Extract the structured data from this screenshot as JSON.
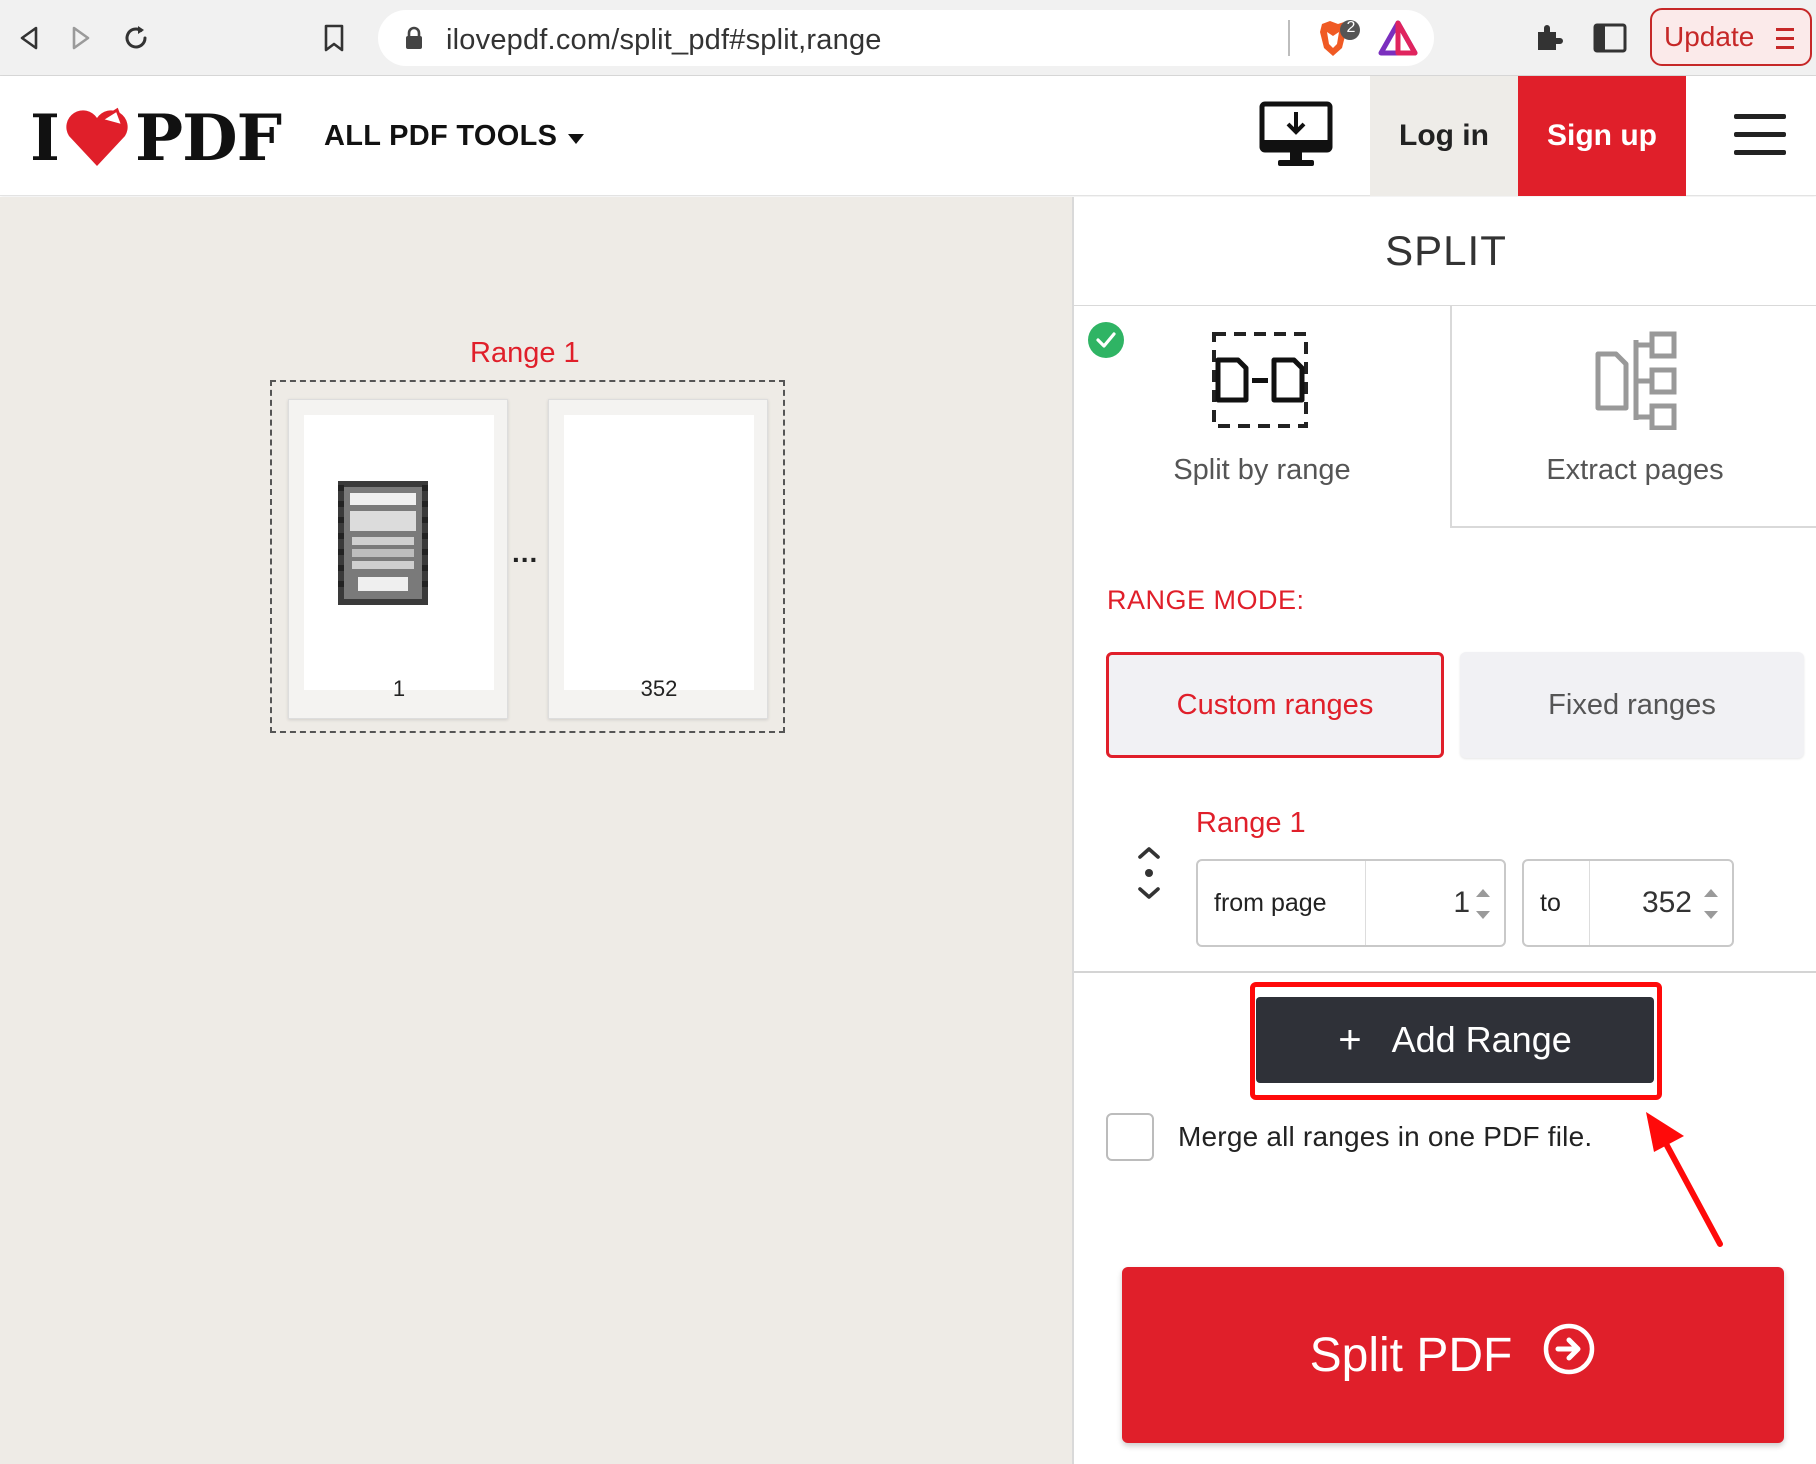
{
  "browser": {
    "url": "ilovepdf.com/split_pdf#split,range",
    "brave_badge_count": "2",
    "update_label": "Update"
  },
  "header": {
    "logo_left": "I",
    "logo_right": "PDF",
    "all_tools_label": "ALL PDF TOOLS",
    "login_label": "Log in",
    "signup_label": "Sign up"
  },
  "preview": {
    "range_label": "Range 1",
    "ellipsis": "...",
    "pages": [
      {
        "number": "1"
      },
      {
        "number": "352"
      }
    ]
  },
  "sidebar": {
    "title": "SPLIT",
    "modes": [
      {
        "label": "Split by range",
        "selected": true
      },
      {
        "label": "Extract pages",
        "selected": false
      }
    ],
    "range_mode_label": "RANGE MODE:",
    "range_mode_options": [
      {
        "label": "Custom ranges",
        "selected": true
      },
      {
        "label": "Fixed ranges",
        "selected": false
      }
    ],
    "range": {
      "title": "Range 1",
      "from_label": "from page",
      "from_value": "1",
      "to_label": "to",
      "to_value": "352"
    },
    "add_range_label": "Add Range",
    "add_range_plus": "+",
    "merge_label": "Merge all ranges in one PDF file.",
    "merge_checked": false,
    "split_button_label": "Split PDF"
  },
  "colors": {
    "brand_red": "#e01f2a",
    "dark_button": "#2f3138",
    "success_green": "#2fb464",
    "workspace_bg": "#eeebe6",
    "annotation_red": "#ff0a0a"
  },
  "icons": [
    "back-arrow-icon",
    "forward-arrow-icon",
    "reload-icon",
    "bookmark-icon",
    "lock-icon",
    "brave-shield-icon",
    "brave-rewards-icon",
    "extensions-icon",
    "sidebar-icon",
    "menu-icon",
    "heart-logo-icon",
    "caret-down-icon",
    "desktop-download-icon",
    "hamburger-icon",
    "check-icon",
    "split-range-icon",
    "extract-pages-icon",
    "drag-handle-icon",
    "spinner-icon",
    "arrow-circle-icon"
  ]
}
